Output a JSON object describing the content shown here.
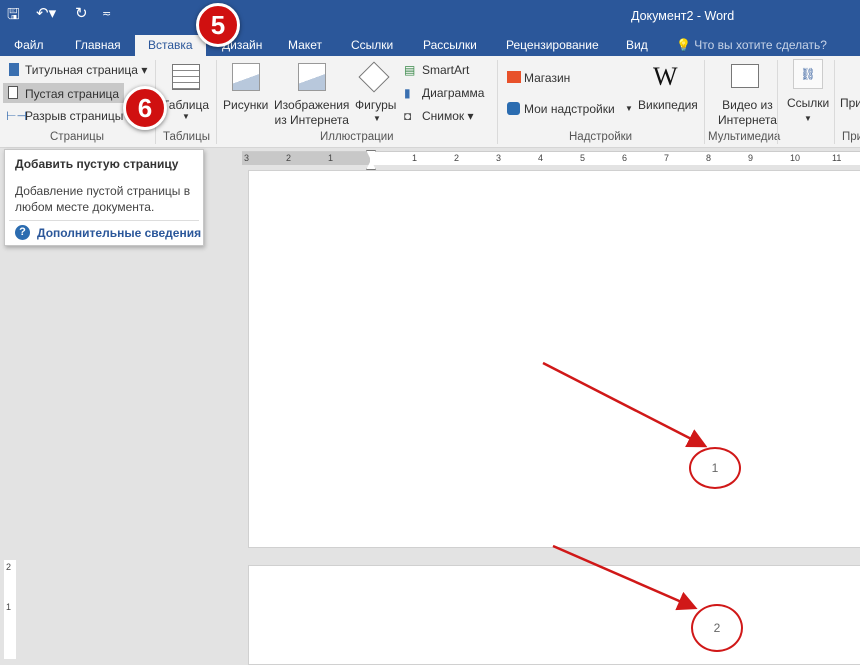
{
  "window": {
    "title": "Документ2 - Word"
  },
  "qat": {
    "save": "save-icon",
    "undo": "undo-icon",
    "redo": "redo-icon",
    "customize": "customize-icon"
  },
  "tabs": [
    {
      "label": "Файл"
    },
    {
      "label": "Главная"
    },
    {
      "label": "Вставка"
    },
    {
      "label": "Дизайн"
    },
    {
      "label": "Макет"
    },
    {
      "label": "Ссылки"
    },
    {
      "label": "Рассылки"
    },
    {
      "label": "Рецензирование"
    },
    {
      "label": "Вид"
    }
  ],
  "tell_me": "Что вы хотите сделать?",
  "ribbon": {
    "pages": {
      "cover": "Титульная страница",
      "blank": "Пустая страница",
      "break": "Разрыв страницы",
      "group": "Страницы"
    },
    "tables": {
      "table": "Таблица",
      "group": "Таблицы"
    },
    "illustrations": {
      "pictures": "Рисунки",
      "online1": "Изображения",
      "online2": "из Интернета",
      "shapes": "Фигуры",
      "smartart": "SmartArt",
      "chart": "Диаграмма",
      "screenshot": "Снимок",
      "group": "Иллюстрации"
    },
    "addins": {
      "store": "Магазин",
      "my": "Мои надстройки",
      "wiki": "Википедия",
      "group": "Надстройки"
    },
    "media": {
      "video1": "Видео из",
      "video2": "Интернета",
      "group": "Мультимедиа"
    },
    "links": {
      "links": "Ссылки",
      "next": "При",
      "group": "При"
    }
  },
  "tooltip": {
    "title": "Добавить пустую страницу",
    "body1": "Добавление пустой страницы в",
    "body2": "любом месте документа.",
    "more": "Дополнительные сведения"
  },
  "ruler": {
    "left": [
      "3",
      "2",
      "1"
    ],
    "right": [
      "1",
      "2",
      "3",
      "4",
      "5",
      "6",
      "7",
      "8",
      "9",
      "10",
      "11"
    ]
  },
  "vruler": [
    "2",
    "1"
  ],
  "annotations": {
    "step5": "5",
    "step6": "6",
    "page1": "1",
    "page2": "2"
  },
  "colors": {
    "accent": "#2b579a",
    "annotation": "#d01010"
  }
}
